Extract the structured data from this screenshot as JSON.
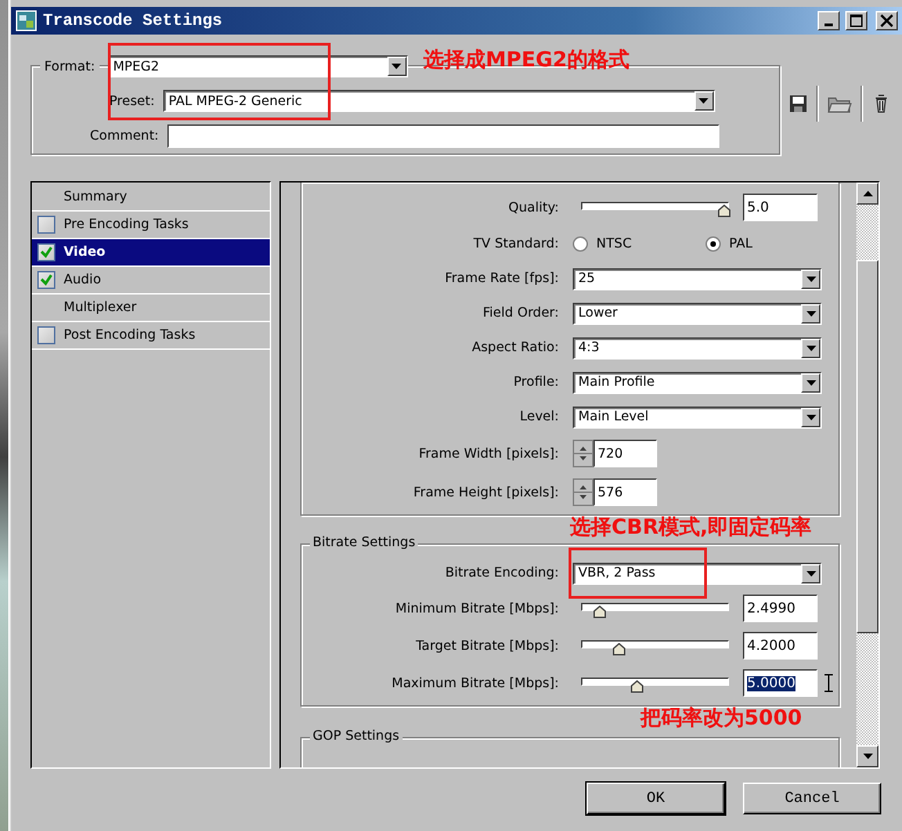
{
  "window": {
    "title": "Transcode Settings"
  },
  "format": {
    "label": "Format:",
    "value": "MPEG2"
  },
  "preset": {
    "label": "Preset:",
    "value": "PAL MPEG-2 Generic"
  },
  "comment": {
    "label": "Comment:"
  },
  "sidebar": {
    "items": [
      {
        "label": "Summary",
        "kind": "plain",
        "selected": false
      },
      {
        "label": "Pre Encoding Tasks",
        "kind": "check",
        "checked": false,
        "selected": false
      },
      {
        "label": "Video",
        "kind": "check",
        "checked": true,
        "selected": true
      },
      {
        "label": "Audio",
        "kind": "check",
        "checked": true,
        "selected": false
      },
      {
        "label": "Multiplexer",
        "kind": "plain",
        "selected": false
      },
      {
        "label": "Post Encoding Tasks",
        "kind": "check",
        "checked": false,
        "selected": false
      }
    ]
  },
  "basic_video_settings": {
    "rows": [
      {
        "kind": "slider",
        "label": "Quality:",
        "level": 0.97,
        "value": "5.0",
        "highlighted": false
      },
      {
        "kind": "radio",
        "label": "TV Standard:",
        "options": [
          {
            "label": "NTSC",
            "selected": false
          },
          {
            "label": "PAL",
            "selected": true
          }
        ]
      },
      {
        "kind": "select",
        "label": "Frame Rate [fps]:",
        "value": "25"
      },
      {
        "kind": "select",
        "label": "Field Order:",
        "value": "Lower"
      },
      {
        "kind": "select",
        "label": "Aspect Ratio:",
        "value": "4:3"
      },
      {
        "kind": "select",
        "label": "Profile:",
        "value": "Main Profile"
      },
      {
        "kind": "select",
        "label": "Level:",
        "value": "Main Level"
      },
      {
        "kind": "spin",
        "label": "Frame Width [pixels]:",
        "value": "720"
      },
      {
        "kind": "spin",
        "label": "Frame Height [pixels]:",
        "value": "576"
      }
    ]
  },
  "bitrate_settings": {
    "title": "Bitrate Settings",
    "rows": [
      {
        "kind": "select",
        "label": "Bitrate Encoding:",
        "value": "VBR, 2 Pass"
      },
      {
        "kind": "slider",
        "label": "Minimum Bitrate [Mbps]:",
        "level": 0.13,
        "value": "2.4990",
        "highlighted": false
      },
      {
        "kind": "slider",
        "label": "Target Bitrate [Mbps]:",
        "level": 0.26,
        "value": "4.2000",
        "highlighted": false
      },
      {
        "kind": "slider",
        "label": "Maximum Bitrate [Mbps]:",
        "level": 0.38,
        "value": "5.0000",
        "highlighted": true
      }
    ]
  },
  "gop_settings": {
    "title": "GOP Settings"
  },
  "buttons": [
    {
      "label": "OK"
    },
    {
      "label": "Cancel"
    }
  ],
  "annotations": [
    {
      "text": "选择成MPEG2的格式"
    },
    {
      "text": "选择CBR模式,即固定码率"
    },
    {
      "text": "把码率改为5000"
    }
  ]
}
